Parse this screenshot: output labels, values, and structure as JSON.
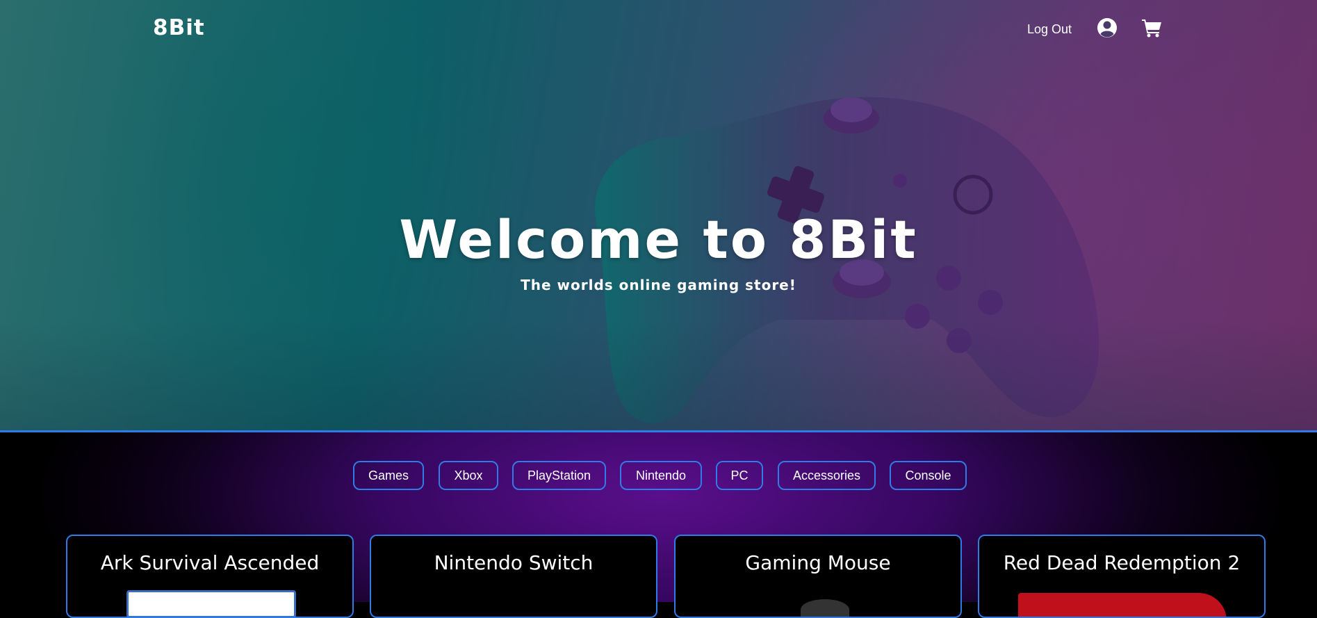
{
  "brand": {
    "logo": "8Bit"
  },
  "nav": {
    "logout_label": "Log Out",
    "user_icon": "user-circle-icon",
    "cart_icon": "shopping-cart-icon"
  },
  "hero": {
    "title": "Welcome to 8Bit",
    "subtitle": "The worlds online gaming store!"
  },
  "categories": [
    "Games",
    "Xbox",
    "PlayStation",
    "Nintendo",
    "PC",
    "Accessories",
    "Console"
  ],
  "products": [
    {
      "title": "Ark Survival Ascended"
    },
    {
      "title": "Nintendo Switch"
    },
    {
      "title": "Gaming Mouse"
    },
    {
      "title": "Red Dead Redemption 2"
    }
  ],
  "colors": {
    "accent": "#2f7be8",
    "hero_teal": "#0c5f66",
    "hero_purple": "#6b2f68",
    "section_purple": "#5a0f8c"
  }
}
